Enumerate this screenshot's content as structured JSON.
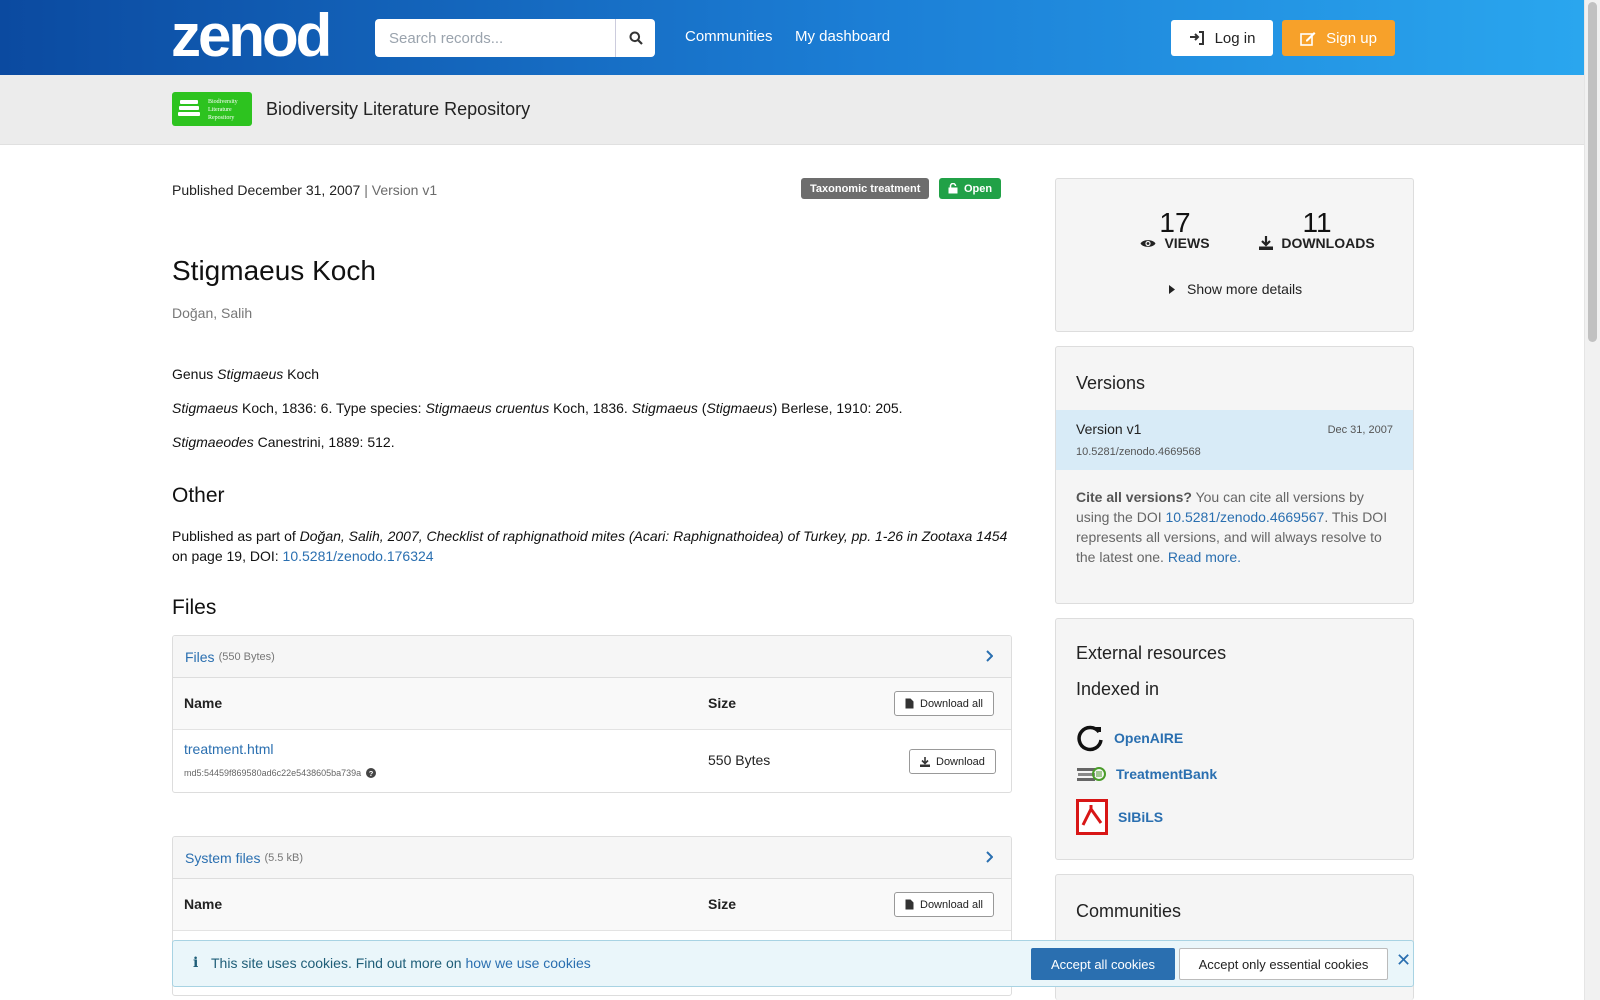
{
  "header": {
    "logo_text": "zenodo",
    "search_placeholder": "Search records...",
    "nav": [
      "Communities",
      "My dashboard"
    ],
    "login_label": "Log in",
    "signup_label": "Sign up"
  },
  "community": {
    "title": "Biodiversity Literature Repository",
    "logo_lines": [
      "Biodiversity",
      "Literature",
      "Repository"
    ]
  },
  "record": {
    "published": "Published December 31, 2007",
    "version": "| Version v1",
    "badge_type": "Taxonomic treatment",
    "badge_access": "Open",
    "title": "Stigmaeus Koch",
    "author": "Doğan, Salih",
    "genus_line": {
      "a": "Genus ",
      "b": "Stigmaeus",
      "c": " Koch"
    },
    "syn_line": {
      "a": "Stigmaeus",
      "b": " Koch, 1836: 6. Type species: ",
      "c": "Stigmaeus cruentus",
      "d": " Koch, 1836. ",
      "e": "Stigmaeus",
      "f": " (",
      "g": "Stigmaeus",
      "h": ") Berlese, 1910: 205."
    },
    "syn2_line": {
      "a": "Stigmaeodes",
      "b": " Canestrini, 1889: 512."
    },
    "other_heading": "Other",
    "other": {
      "a": "Published as part of ",
      "b": "Doğan, Salih, 2007, Checklist of raphignathoid mites (Acari: Raphignathoidea) of Turkey, pp. 1-26 in Zootaxa 1454",
      "c": " on page 19, DOI: ",
      "doi": "10.5281/zenodo.176324"
    },
    "files_heading": "Files"
  },
  "files": {
    "label": "Files",
    "size": "(550 Bytes)",
    "col_name": "Name",
    "col_size": "Size",
    "download_all": "Download all",
    "rows": [
      {
        "name": "treatment.html",
        "md5": "md5:54459f869580ad6c22e5438605ba739a",
        "size": "550 Bytes",
        "download": "Download"
      }
    ]
  },
  "system_files": {
    "label": "System files",
    "size": "(5.5 kB)",
    "col_name": "Name",
    "col_size": "Size",
    "download_all": "Download all"
  },
  "stats": {
    "views": "17",
    "views_label": "VIEWS",
    "downloads": "11",
    "downloads_label": "DOWNLOADS",
    "more": "Show more details"
  },
  "versions": {
    "heading": "Versions",
    "current": {
      "label": "Version v1",
      "date": "Dec 31, 2007",
      "doi": "10.5281/zenodo.4669568"
    },
    "cite": {
      "bold": "Cite all versions?",
      "a": " You can cite all versions by using the DOI ",
      "doi": "10.5281/zenodo.4669567",
      "b": ". This DOI represents all versions, and will always resolve to the latest one. ",
      "read_more": "Read more."
    }
  },
  "external": {
    "heading": "External resources",
    "indexed_in": "Indexed in",
    "items": [
      "OpenAIRE",
      "TreatmentBank",
      "SIBiLS"
    ]
  },
  "communities": {
    "heading": "Communities"
  },
  "cookie": {
    "msg": "This site uses cookies. Find out more on ",
    "link": "how we use cookies",
    "accept_all": "Accept all cookies",
    "accept_essential": "Accept only essential cookies",
    "close": "✕",
    "info_glyph": "i"
  },
  "colors": {
    "brand": "#1c7fd6",
    "signup": "#f7a12a",
    "open": "#21a147",
    "link": "#2a6fb0"
  }
}
